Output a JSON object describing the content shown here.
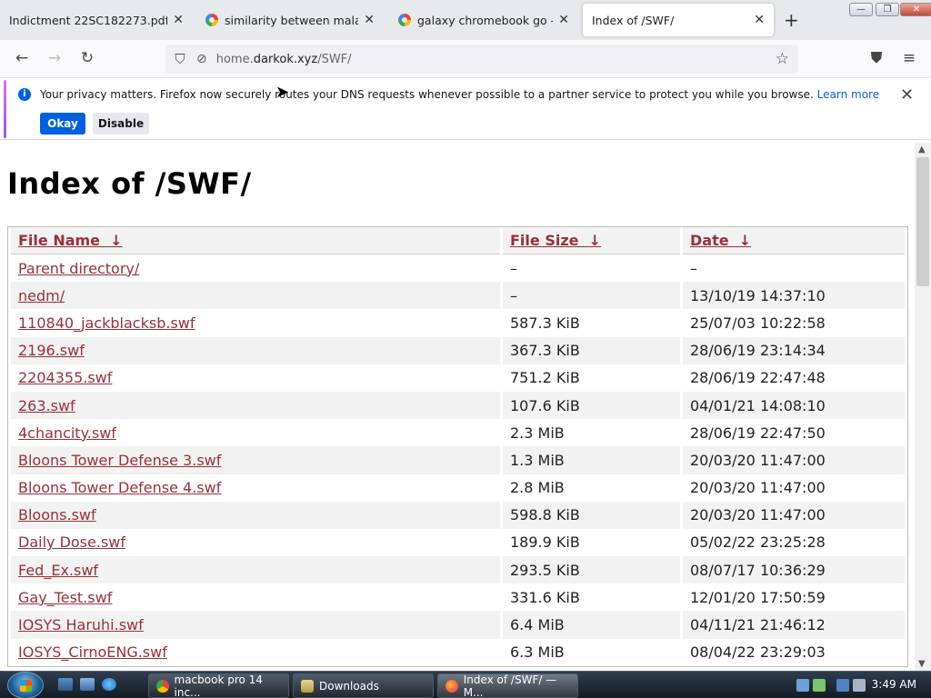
{
  "browser": {
    "tabs": [
      {
        "title": "Indictment 22SC182273.pdf",
        "icon": "pdf-icon"
      },
      {
        "title": "similarity between malay and",
        "icon": "google-icon"
      },
      {
        "title": "galaxy chromebook go - Goo",
        "icon": "google-icon"
      },
      {
        "title": "Index of /SWF/",
        "icon": "none",
        "active": true
      }
    ],
    "url_host": "home.",
    "url_domain": "darkok.xyz",
    "url_path": "/SWF/"
  },
  "notification": {
    "text": "Your privacy matters. Firefox now securely routes your DNS requests whenever possible to a partner service to protect you while you browse.",
    "link": "Learn more",
    "okay": "Okay",
    "disable": "Disable"
  },
  "page": {
    "title": "Index of /SWF/",
    "headers": {
      "name": "File Name",
      "size": "File Size",
      "date": "Date",
      "sort_glyph": "↓"
    },
    "rows": [
      {
        "name": "Parent directory/",
        "size": "–",
        "date": "–"
      },
      {
        "name": "nedm/",
        "size": "–",
        "date": "13/10/19 14:37:10"
      },
      {
        "name": "110840_jackblacksb.swf",
        "size": "587.3 KiB",
        "date": "25/07/03 10:22:58"
      },
      {
        "name": "2196.swf",
        "size": "367.3 KiB",
        "date": "28/06/19 23:14:34"
      },
      {
        "name": "2204355.swf",
        "size": "751.2 KiB",
        "date": "28/06/19 22:47:48"
      },
      {
        "name": "263.swf",
        "size": "107.6 KiB",
        "date": "04/01/21 14:08:10"
      },
      {
        "name": "4chancity.swf",
        "size": "2.3 MiB",
        "date": "28/06/19 22:47:50"
      },
      {
        "name": "Bloons Tower Defense 3.swf",
        "size": "1.3 MiB",
        "date": "20/03/20 11:47:00"
      },
      {
        "name": "Bloons Tower Defense 4.swf",
        "size": "2.8 MiB",
        "date": "20/03/20 11:47:00"
      },
      {
        "name": "Bloons.swf",
        "size": "598.8 KiB",
        "date": "20/03/20 11:47:00"
      },
      {
        "name": "Daily Dose.swf",
        "size": "189.9 KiB",
        "date": "05/02/22 23:25:28"
      },
      {
        "name": "Fed_Ex.swf",
        "size": "293.5 KiB",
        "date": "08/07/17 10:36:29"
      },
      {
        "name": "Gay_Test.swf",
        "size": "331.6 KiB",
        "date": "12/01/20 17:50:59"
      },
      {
        "name": "IOSYS Haruhi.swf",
        "size": "6.4 MiB",
        "date": "04/11/21 21:46:12"
      },
      {
        "name": "IOSYS_CirnoENG.swf",
        "size": "6.3 MiB",
        "date": "08/04/22 23:29:03"
      }
    ]
  },
  "taskbar": {
    "items": [
      {
        "label": "macbook pro 14 inc...",
        "icon": "chrome-icon"
      },
      {
        "label": "Downloads",
        "icon": "folder-icon"
      },
      {
        "label": "Index of /SWF/ — M...",
        "icon": "firefox-icon",
        "active": true
      }
    ],
    "clock": "3:49 AM"
  },
  "colors": {
    "link": "#99303a",
    "accent": "#0060df"
  }
}
